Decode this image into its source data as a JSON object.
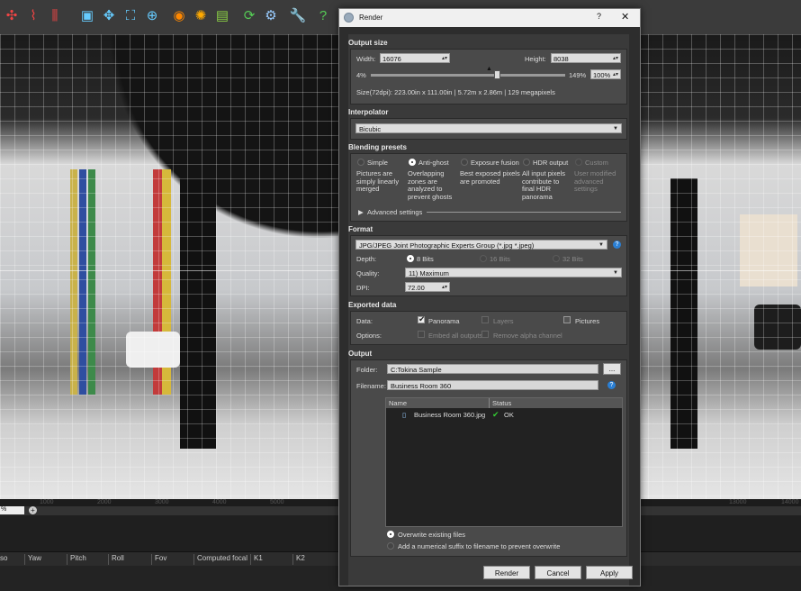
{
  "background": {
    "zoom_value": "%",
    "ruler_ticks": [
      "1000",
      "2000",
      "3000",
      "4000",
      "5000",
      "",
      "13000",
      "14000"
    ],
    "columns": [
      "so",
      "Yaw",
      "Pitch",
      "Roll",
      "Fov",
      "Computed focal",
      "K1",
      "K2"
    ]
  },
  "dialog": {
    "title": "Render",
    "help_label": "?",
    "close_label": "✕",
    "output_size": {
      "section": "Output size",
      "width_label": "Width:",
      "width_value": "16076",
      "height_label": "Height:",
      "height_value": "8038",
      "min_label": "4%",
      "max_label": "149%",
      "percent_value": "100%",
      "size_info": "Size(72dpi): 223.00in x 111.00in | 5.72m x 2.86m | 129 megapixels"
    },
    "interpolator": {
      "section": "Interpolator",
      "value": "Bicubic"
    },
    "blending": {
      "section": "Blending presets",
      "options": [
        {
          "label": "Simple",
          "desc": "Pictures are simply linearly merged"
        },
        {
          "label": "Anti-ghost",
          "desc": "Overlapping zones are analyzed to prevent ghosts"
        },
        {
          "label": "Exposure fusion",
          "desc": "Best exposed pixels are promoted"
        },
        {
          "label": "HDR output",
          "desc": "All input pixels contribute to final HDR panorama"
        },
        {
          "label": "Custom",
          "desc": "User modified advanced settings"
        }
      ],
      "advanced_label": "Advanced settings"
    },
    "format": {
      "section": "Format",
      "value": "JPG/JPEG Joint Photographic Experts Group (*.jpg *.jpeg)",
      "depth_label": "Depth:",
      "depth_options": [
        "8 Bits",
        "16 Bits",
        "32 Bits"
      ],
      "quality_label": "Quality:",
      "quality_value": "11) Maximum",
      "dpi_label": "DPI:",
      "dpi_value": "72.00"
    },
    "exported": {
      "section": "Exported data",
      "data_label": "Data:",
      "panorama": "Panorama",
      "layers": "Layers",
      "pictures": "Pictures",
      "options_label": "Options:",
      "embed": "Embed all outputs",
      "remove_alpha": "Remove alpha channel"
    },
    "output": {
      "section": "Output",
      "folder_label": "Folder:",
      "folder_value": "C:Tokina Sample",
      "browse_label": "...",
      "filename_label": "Filename:",
      "filename_value": "Business Room 360",
      "col_name": "Name",
      "col_status": "Status",
      "file_name": "Business Room 360.jpg",
      "file_status": "OK",
      "overwrite": "Overwrite existing files",
      "suffix": "Add a numerical suffix to filename to prevent overwrite"
    },
    "buttons": {
      "render": "Render",
      "cancel": "Cancel",
      "apply": "Apply"
    }
  }
}
